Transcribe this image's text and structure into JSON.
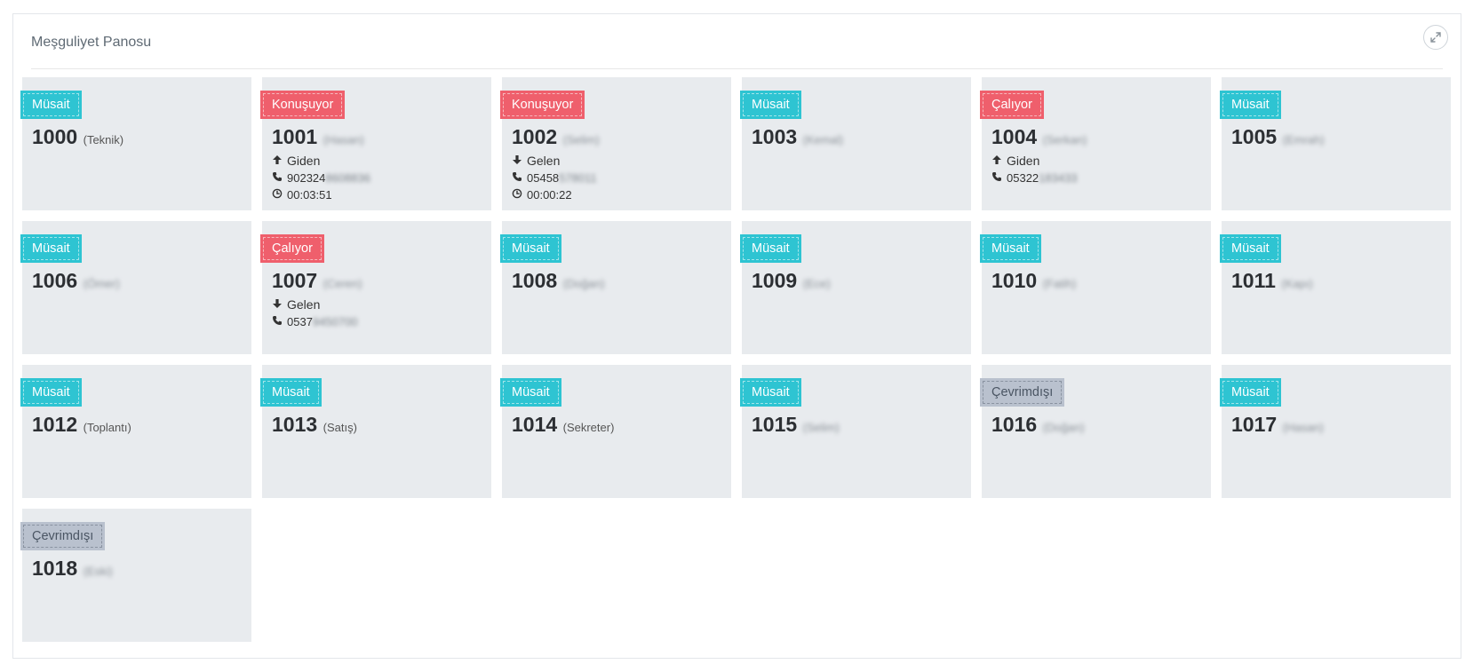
{
  "panel": {
    "title": "Meşguliyet Panosu",
    "expand_icon": "expand-arrows-icon"
  },
  "colors": {
    "available": "#2ec4d2",
    "busy": "#ef5f6c",
    "offline": "#b9c1ce",
    "card_bg": "#e8ebee"
  },
  "extensions": [
    {
      "number": "1000",
      "name": "(Teknik)",
      "name_blurred": false,
      "status": "Müsait",
      "status_type": "available"
    },
    {
      "number": "1001",
      "name": "(Hasan)",
      "name_blurred": true,
      "status": "Konuşuyor",
      "status_type": "busy",
      "direction": "Giden",
      "direction_icon": "arrow-up-icon",
      "phone": "902324",
      "phone_hidden": "8608836",
      "duration": "00:03:51"
    },
    {
      "number": "1002",
      "name": "(Selim)",
      "name_blurred": true,
      "status": "Konuşuyor",
      "status_type": "busy",
      "direction": "Gelen",
      "direction_icon": "arrow-down-icon",
      "phone": "05458",
      "phone_hidden": "578011",
      "duration": "00:00:22"
    },
    {
      "number": "1003",
      "name": "(Kemal)",
      "name_blurred": true,
      "status": "Müsait",
      "status_type": "available"
    },
    {
      "number": "1004",
      "name": "(Serkan)",
      "name_blurred": true,
      "status": "Çalıyor",
      "status_type": "busy",
      "direction": "Giden",
      "direction_icon": "arrow-up-icon",
      "phone": "05322",
      "phone_hidden": "183433"
    },
    {
      "number": "1005",
      "name": "(Emrah)",
      "name_blurred": true,
      "status": "Müsait",
      "status_type": "available"
    },
    {
      "number": "1006",
      "name": "(Ömer)",
      "name_blurred": true,
      "status": "Müsait",
      "status_type": "available"
    },
    {
      "number": "1007",
      "name": "(Ceren)",
      "name_blurred": true,
      "status": "Çalıyor",
      "status_type": "busy",
      "direction": "Gelen",
      "direction_icon": "arrow-down-icon",
      "phone": "0537",
      "phone_hidden": "9450700"
    },
    {
      "number": "1008",
      "name": "(Doğan)",
      "name_blurred": true,
      "status": "Müsait",
      "status_type": "available"
    },
    {
      "number": "1009",
      "name": "(Ece)",
      "name_blurred": true,
      "status": "Müsait",
      "status_type": "available"
    },
    {
      "number": "1010",
      "name": "(Fatih)",
      "name_blurred": true,
      "status": "Müsait",
      "status_type": "available"
    },
    {
      "number": "1011",
      "name": "(Kapı)",
      "name_blurred": true,
      "status": "Müsait",
      "status_type": "available"
    },
    {
      "number": "1012",
      "name": "(Toplantı)",
      "name_blurred": false,
      "status": "Müsait",
      "status_type": "available"
    },
    {
      "number": "1013",
      "name": "(Satış)",
      "name_blurred": false,
      "status": "Müsait",
      "status_type": "available"
    },
    {
      "number": "1014",
      "name": "(Sekreter)",
      "name_blurred": false,
      "status": "Müsait",
      "status_type": "available"
    },
    {
      "number": "1015",
      "name": "(Selim)",
      "name_blurred": true,
      "status": "Müsait",
      "status_type": "available"
    },
    {
      "number": "1016",
      "name": "(Doğan)",
      "name_blurred": true,
      "status": "Çevrimdışı",
      "status_type": "offline"
    },
    {
      "number": "1017",
      "name": "(Hasan)",
      "name_blurred": true,
      "status": "Müsait",
      "status_type": "available"
    },
    {
      "number": "1018",
      "name": "(Eski)",
      "name_blurred": true,
      "status": "Çevrimdışı",
      "status_type": "offline"
    }
  ]
}
